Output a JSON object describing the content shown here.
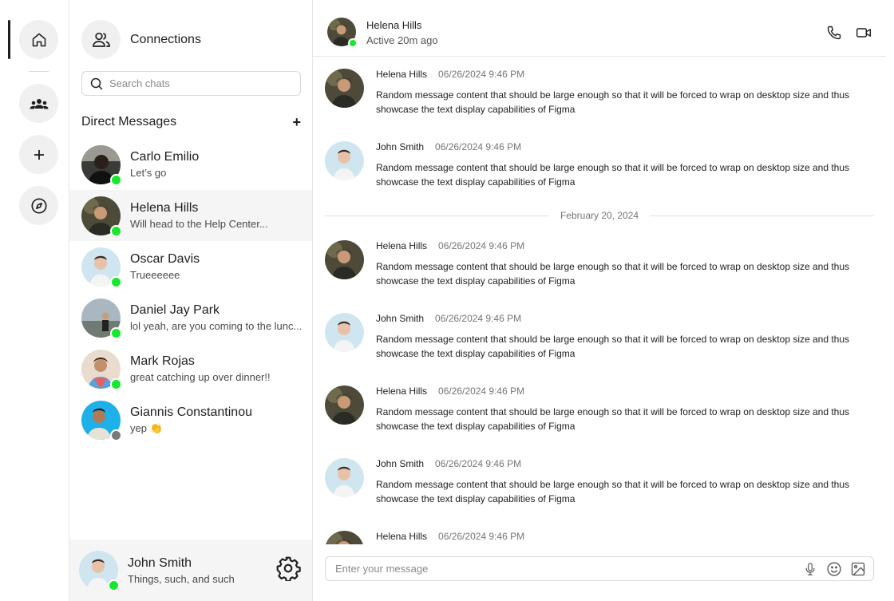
{
  "rail": {
    "items": [
      {
        "name": "home-icon"
      },
      {
        "name": "groups-icon"
      },
      {
        "name": "plus-icon"
      },
      {
        "name": "compass-icon"
      }
    ]
  },
  "panel": {
    "title": "Connections",
    "search_placeholder": "Search chats",
    "dm_title": "Direct Messages",
    "dm_add": "+",
    "chats": [
      {
        "name": "Carlo Emilio",
        "preview": "Let’s go",
        "online": true
      },
      {
        "name": "Helena Hills",
        "preview": "Will head to the Help Center...",
        "online": true,
        "active": true
      },
      {
        "name": "Oscar Davis",
        "preview": "Trueeeeee",
        "online": true
      },
      {
        "name": "Daniel Jay Park",
        "preview": "lol yeah, are you coming to the lunc...",
        "online": true
      },
      {
        "name": "Mark Rojas",
        "preview": "great catching up over dinner!!",
        "online": true
      },
      {
        "name": "Giannis Constantinou",
        "preview": "yep 👏",
        "online": false
      }
    ],
    "me": {
      "name": "John Smith",
      "status": "Things, such, and such"
    }
  },
  "conversation": {
    "name": "Helena Hills",
    "status": "Active 20m ago",
    "date_divider": "February 20, 2024",
    "message_text": "Random message content that should be large enough so that it will be forced to wrap on desktop size and thus showcase the text display capabilities of Figma",
    "messages": [
      {
        "author": "Helena Hills",
        "time": "06/26/2024 9:46 PM"
      },
      {
        "author": "John Smith",
        "time": "06/26/2024 9:46 PM"
      },
      {
        "author": "Helena Hills",
        "time": "06/26/2024 9:46 PM"
      },
      {
        "author": "John Smith",
        "time": "06/26/2024 9:46 PM"
      },
      {
        "author": "Helena Hills",
        "time": "06/26/2024 9:46 PM"
      },
      {
        "author": "John Smith",
        "time": "06/26/2024 9:46 PM"
      },
      {
        "author": "Helena Hills",
        "time": "06/26/2024 9:46 PM"
      }
    ],
    "composer_placeholder": "Enter your message"
  },
  "colors": {
    "online": "#14ea2a",
    "offline": "#7a7a7a",
    "active_bg": "#f5f5f5"
  }
}
